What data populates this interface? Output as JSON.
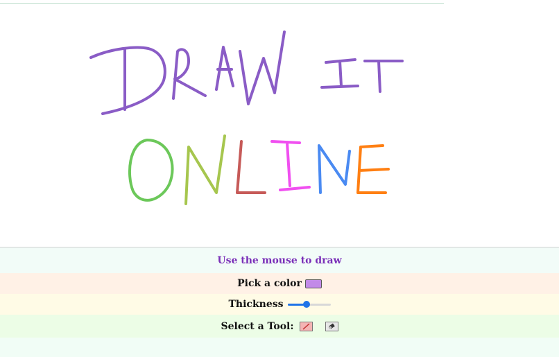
{
  "canvas": {
    "drawing_words": [
      "DRAW IT",
      "ONLINE"
    ],
    "stroke_colors": {
      "draw_it": "#8a5cc6",
      "O": "#6cc85a",
      "N": "#a6c64e",
      "L": "#c65a58",
      "I": "#f04ff0",
      "N2": "#4a8af2",
      "E": "#ff7f12"
    }
  },
  "panel": {
    "instruction": "Use the mouse to draw",
    "pick_color_label": "Pick a color",
    "selected_color": "#c28ae8",
    "thickness_label": "Thickness",
    "thickness_level": 0.45,
    "tool_label": "Select a Tool:",
    "tools": [
      "pencil",
      "eraser"
    ]
  },
  "icons": {
    "pencil": "pencil-icon",
    "eraser": "eraser-icon"
  }
}
